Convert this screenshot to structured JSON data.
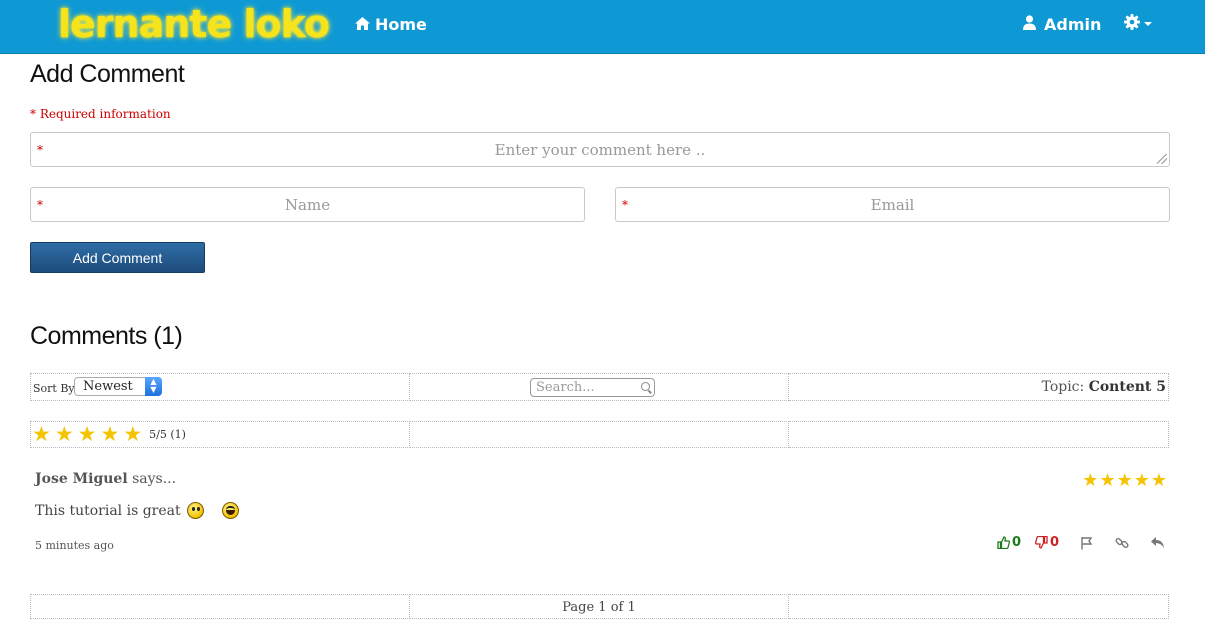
{
  "navbar": {
    "brand": "lernante loko",
    "home_label": "Home",
    "admin_label": "Admin"
  },
  "add_comment": {
    "title": "Add Comment",
    "required_note": "* Required information",
    "required_marker": "*",
    "comment_placeholder": "Enter your comment here ..",
    "name_placeholder": "Name",
    "email_placeholder": "Email",
    "submit_label": "Add Comment"
  },
  "comments": {
    "title": "Comments (1)",
    "sort_label": "Sort By",
    "sort_value": "Newest",
    "search_placeholder": "Search...",
    "topic_label": "Topic:",
    "topic_value": "Content 5",
    "overall_rating_text": "5/5 (1)",
    "overall_stars": 5,
    "items": [
      {
        "author": "Jose Miguel",
        "says": " says...",
        "stars": 5,
        "text": "This tutorial is great",
        "time": "5 minutes ago",
        "likes": "0",
        "dislikes": "0"
      }
    ],
    "pagination": "Page 1 of 1"
  },
  "colors": {
    "navbar_bg": "#0f99d4",
    "brand": "#f5e31c",
    "required": "#cc0000",
    "button": "#1d4c7c",
    "star": "#f5c400",
    "like": "#1a7a1a",
    "dislike": "#cc2222"
  }
}
